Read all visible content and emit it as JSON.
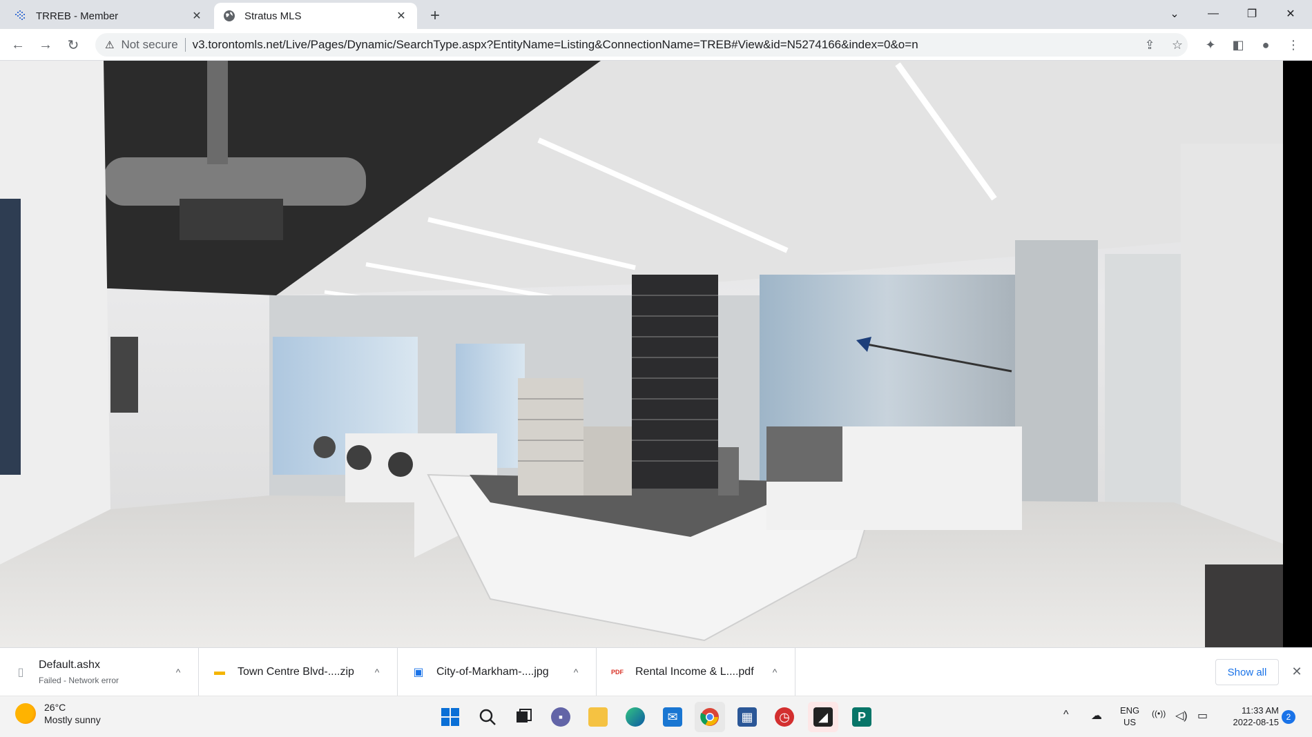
{
  "tabs": [
    {
      "title": "TRREB - Member",
      "favicon": "trreb-logo-icon",
      "active": false
    },
    {
      "title": "Stratus MLS",
      "favicon": "globe-icon",
      "active": true
    }
  ],
  "window_controls": {
    "minimize": "—",
    "restore": "❐",
    "close": "✕",
    "tab_search": "⌄"
  },
  "toolbar": {
    "back": "←",
    "forward": "→",
    "reload": "↻",
    "security_warning": "⚠",
    "security_label": "Not secure",
    "url": "v3.torontomls.net/Live/Pages/Dynamic/SearchType.aspx?EntityName=Listing&ConnectionName=TREB#View&id=N5274166&index=0&o=n",
    "icons": {
      "share": "⇪",
      "bookmark": "☆",
      "extensions": "✦",
      "sidepanel": "◧",
      "profile": "●",
      "menu": "⋮"
    }
  },
  "downloads": {
    "items": [
      {
        "name": "Default.ashx",
        "status": "Failed - Network error",
        "icon": "file-icon",
        "glyph": "▯"
      },
      {
        "name": "Town Centre Blvd-....zip",
        "status": "",
        "icon": "zip-folder-icon",
        "glyph": "▬"
      },
      {
        "name": "City-of-Markham-....jpg",
        "status": "",
        "icon": "image-file-icon",
        "glyph": "▣"
      },
      {
        "name": "Rental Income & L....pdf",
        "status": "",
        "icon": "pdf-file-icon",
        "glyph": "PDF"
      }
    ],
    "chevron": "^",
    "show_all": "Show all",
    "close": "✕"
  },
  "taskbar": {
    "weather": {
      "temp": "26°C",
      "condition": "Mostly sunny"
    },
    "language": {
      "line1": "ENG",
      "line2": "US"
    },
    "clock": {
      "time": "11:33 AM",
      "date": "2022-08-15"
    },
    "notifications": "2",
    "tray": {
      "chevron": "^",
      "network": "☁",
      "wifi": "((•))",
      "volume": "◁)",
      "battery": "▭"
    }
  },
  "colors": {
    "accent": "#1a73e8",
    "tabstrip": "#dee1e6",
    "taskbar": "#f3f3f3"
  }
}
